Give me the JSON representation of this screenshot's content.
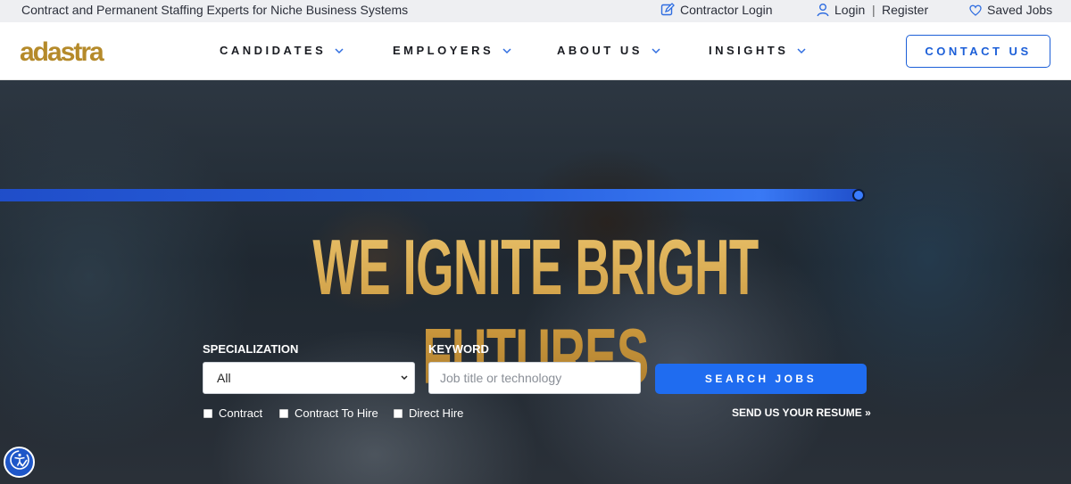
{
  "topbar": {
    "tagline": "Contract and Permanent Staffing Experts for Niche Business Systems",
    "contractor_login": "Contractor Login",
    "login": "Login",
    "separator": "|",
    "register": "Register",
    "saved_jobs": "Saved Jobs"
  },
  "nav": {
    "logo": "adastra",
    "items": [
      "CANDIDATES",
      "EMPLOYERS",
      "ABOUT US",
      "INSIGHTS"
    ],
    "contact": "CONTACT US"
  },
  "hero": {
    "headline": "WE IGNITE BRIGHT FUTURES",
    "specialization_label": "SPECIALIZATION",
    "specialization_value": "All",
    "keyword_label": "KEYWORD",
    "keyword_placeholder": "Job title or technology",
    "search_button": "SEARCH JOBS",
    "checkboxes": [
      "Contract",
      "Contract To Hire",
      "Direct Hire"
    ],
    "resume_link": "SEND US YOUR RESUME »"
  },
  "colors": {
    "accent": "#1f6cf0",
    "gold": "#c9963c"
  },
  "icons": {
    "contractor_login": "edit-icon",
    "login": "user-icon",
    "saved_jobs": "heart-icon",
    "accessibility": "accessibility-icon"
  }
}
